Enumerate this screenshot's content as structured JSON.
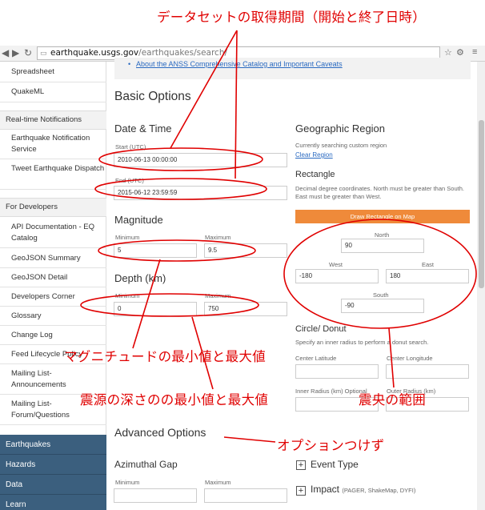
{
  "browser": {
    "url_host": "earthquake.usgs.gov",
    "url_path": "/earthquakes/search/"
  },
  "sidebar": {
    "items": [
      {
        "label": "Spreadsheet"
      },
      {
        "label": "QuakeML"
      }
    ],
    "realtime_heading": "Real-time Notifications",
    "realtime_items": [
      {
        "label": "Earthquake Notification Service"
      },
      {
        "label": "Tweet Earthquake Dispatch"
      }
    ],
    "developers_heading": "For Developers",
    "developers_items": [
      {
        "label": "API Documentation - EQ Catalog"
      },
      {
        "label": "GeoJSON Summary"
      },
      {
        "label": "GeoJSON Detail"
      },
      {
        "label": "Developers Corner"
      },
      {
        "label": "Glossary"
      },
      {
        "label": "Change Log"
      },
      {
        "label": "Feed Lifecycle Policy"
      },
      {
        "label": "Mailing List-Announcements"
      },
      {
        "label": "Mailing List-Forum/Questions"
      }
    ],
    "nav": [
      {
        "label": "Earthquakes"
      },
      {
        "label": "Hazards"
      },
      {
        "label": "Data"
      },
      {
        "label": "Learn"
      }
    ]
  },
  "main": {
    "top_link": "About the ANSS Comprehensive Catalog and Important Caveats",
    "basic_options": "Basic Options",
    "date_time": {
      "heading": "Date & Time",
      "start_label": "Start (UTC)",
      "start_value": "2010-06-13 00:00:00",
      "end_label": "End (UTC)",
      "end_value": "2015-06-12 23:59:59"
    },
    "magnitude": {
      "heading": "Magnitude",
      "min_label": "Minimum",
      "max_label": "Maximum",
      "min_value": "5",
      "max_value": "9.5"
    },
    "depth": {
      "heading": "Depth (km)",
      "min_label": "Minimum",
      "max_label": "Maximum",
      "min_value": "0",
      "max_value": "750"
    },
    "geographic": {
      "heading": "Geographic Region",
      "note": "Currently searching custom region",
      "clear_link": "Clear Region",
      "rectangle_heading": "Rectangle",
      "rectangle_note": "Decimal degree coordinates. North must be greater than South. East must be greater than West.",
      "draw_button": "Draw Rectangle on Map",
      "north_label": "North",
      "north_value": "90",
      "west_label": "West",
      "west_value": "-180",
      "east_label": "East",
      "east_value": "180",
      "south_label": "South",
      "south_value": "-90"
    },
    "circle": {
      "heading": "Circle/ Donut",
      "note": "Specify an inner radius to perform a donut search.",
      "center_lat": "Center Latitude",
      "center_lon": "Center Longitude",
      "inner_radius": "Inner Radius (km) Optional",
      "outer_radius": "Outer Radius (km)"
    },
    "advanced_options": "Advanced Options",
    "azimuthal": {
      "heading": "Azimuthal Gap",
      "min_label": "Minimum",
      "max_label": "Maximum"
    },
    "event_type": "Event Type",
    "impact": "Impact",
    "impact_note": "(PAGER, ShakeMap, DYFI)"
  },
  "annotations": {
    "date_range": "データセットの取得期間（開始と終了日時）",
    "magnitude": "マグニチュードの最小値と最大値",
    "depth": "震源の深さのの最小値と最大値",
    "epicenter": "震央の範囲",
    "advanced": "オプションつけず"
  },
  "colors": {
    "annotation_red": "#e00000",
    "draw_button_orange": "#ef8a3a",
    "nav_dark": "#3b5f7e",
    "link_blue": "#2a6ac1"
  }
}
